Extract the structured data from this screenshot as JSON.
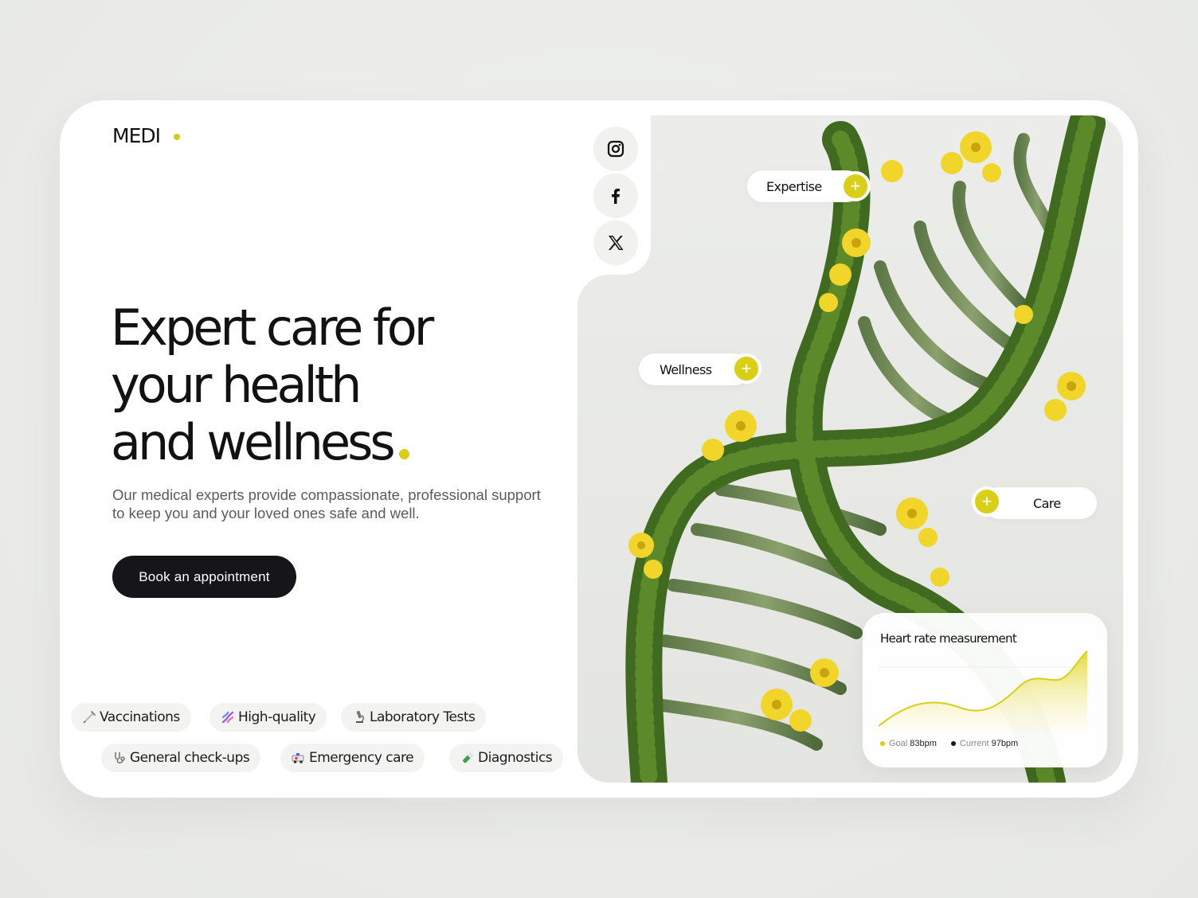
{
  "brand": {
    "logo": "MEDI",
    "accent": "#d9ce18",
    "dark": "#16161a"
  },
  "hero": {
    "headline_lines": [
      "Expert care for",
      "your health",
      "and wellness"
    ],
    "subtext": "Our medical experts provide compassionate, professional support to keep you and your loved ones safe and well.",
    "cta_label": "Book an appointment"
  },
  "services": [
    {
      "label": "Vaccinations",
      "icon": "syringe-icon"
    },
    {
      "label": "High-quality",
      "icon": "dna-icon"
    },
    {
      "label": "Laboratory Tests",
      "icon": "microscope-icon"
    },
    {
      "label": "General check-ups",
      "icon": "stethoscope-icon"
    },
    {
      "label": "Emergency care",
      "icon": "ambulance-icon"
    },
    {
      "label": "Diagnostics",
      "icon": "test-tube-icon"
    }
  ],
  "socials": [
    {
      "icon": "instagram-icon"
    },
    {
      "icon": "facebook-icon"
    },
    {
      "icon": "x-icon"
    }
  ],
  "hotspots": [
    {
      "label": "Expertise"
    },
    {
      "label": "Wellness"
    },
    {
      "label": "Care"
    }
  ],
  "heart_rate": {
    "title": "Heart rate measurement",
    "goal_label": "Goal",
    "goal_value": "83bpm",
    "current_label": "Current",
    "current_value": "97bpm"
  }
}
